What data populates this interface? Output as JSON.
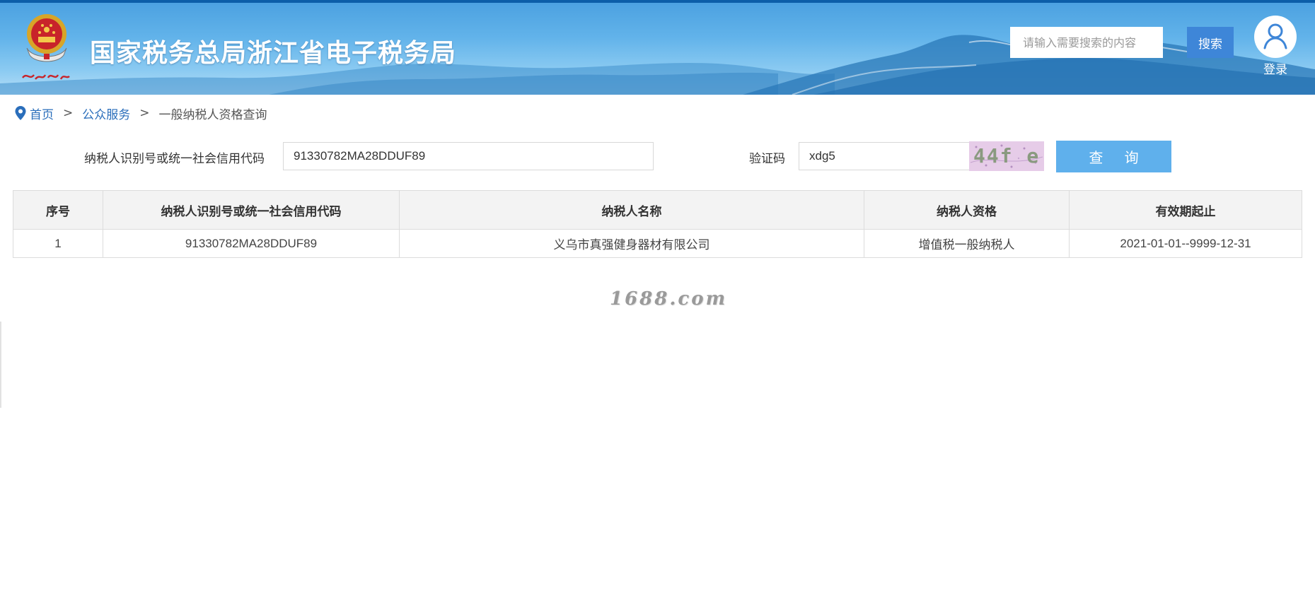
{
  "header": {
    "site_title": "国家税务总局浙江省电子税务局",
    "emblem_icon": "tax-emblem-icon",
    "emblem_caption": "中国税务",
    "search_placeholder": "请输入需要搜索的内容",
    "search_label": "搜索",
    "login_label": "登录",
    "colors": {
      "banner": "#4aa0e0",
      "search_button": "#3e86d8",
      "top_line": "#0c5ea8"
    }
  },
  "breadcrumb": {
    "icon": "location-pin-icon",
    "items": [
      "首页",
      "公众服务",
      "一般纳税人资格查询"
    ],
    "separator": ">"
  },
  "query_form": {
    "taxpayer_id_label": "纳税人识别号或统一社会信用代码",
    "taxpayer_id_value": "91330782MA28DDUF89",
    "captcha_label": "验证码",
    "captcha_input_value": "xdg5",
    "captcha_image_text": "44f e",
    "query_button_label": "查 询",
    "colors": {
      "query_button": "#5fb0ec"
    }
  },
  "results_table": {
    "columns": [
      "序号",
      "纳税人识别号或统一社会信用代码",
      "纳税人名称",
      "纳税人资格",
      "有效期起止"
    ],
    "rows": [
      [
        "1",
        "91330782MA28DDUF89",
        "义乌市真强健身器材有限公司",
        "增值税一般纳税人",
        "2021-01-01--9999-12-31"
      ]
    ]
  },
  "watermark": "1688.com"
}
